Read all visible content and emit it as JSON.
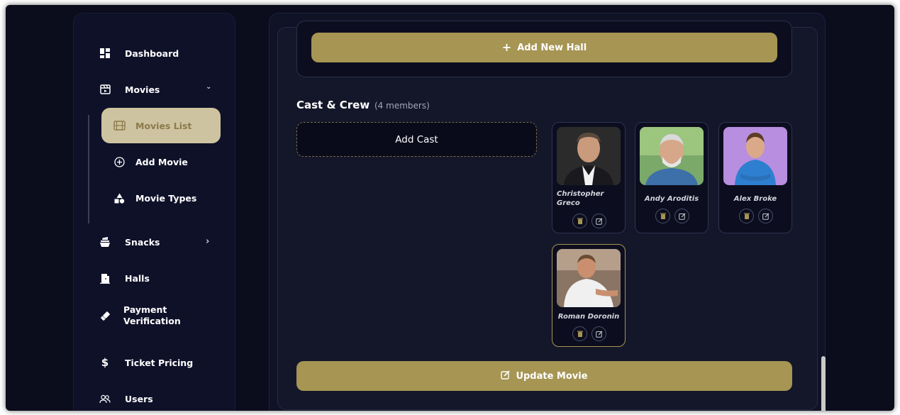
{
  "sidebar": {
    "items": [
      {
        "label": "Dashboard",
        "icon": "dashboard-icon"
      },
      {
        "label": "Movies",
        "icon": "movies-icon"
      },
      {
        "label": "Snacks",
        "icon": "snacks-icon"
      },
      {
        "label": "Halls",
        "icon": "halls-icon"
      },
      {
        "label": "Payment\nVerification",
        "icon": "ticket-icon"
      },
      {
        "label": "Ticket Pricing",
        "icon": "dollar-icon"
      },
      {
        "label": "Users",
        "icon": "users-icon"
      }
    ],
    "movies_sub": [
      {
        "label": "Movies List",
        "icon": "film-icon"
      },
      {
        "label": "Add Movie",
        "icon": "plus-circle-icon"
      },
      {
        "label": "Movie Types",
        "icon": "shapes-icon"
      }
    ],
    "chevron_down": "⌄",
    "chevron_right": "›"
  },
  "main": {
    "add_hall_label": "Add New Hall",
    "cast_title": "Cast & Crew",
    "cast_count": "(4 members)",
    "add_cast_label": "Add Cast",
    "update_label": "Update Movie",
    "cast": [
      {
        "name": "Christopher Greco"
      },
      {
        "name": "Andy Aroditis"
      },
      {
        "name": "Alex Broke"
      },
      {
        "name": "Roman Doronin"
      }
    ]
  },
  "colors": {
    "accent": "#a69553",
    "active_sub_bg": "#cec3a0",
    "background": "#0b0c1c"
  }
}
